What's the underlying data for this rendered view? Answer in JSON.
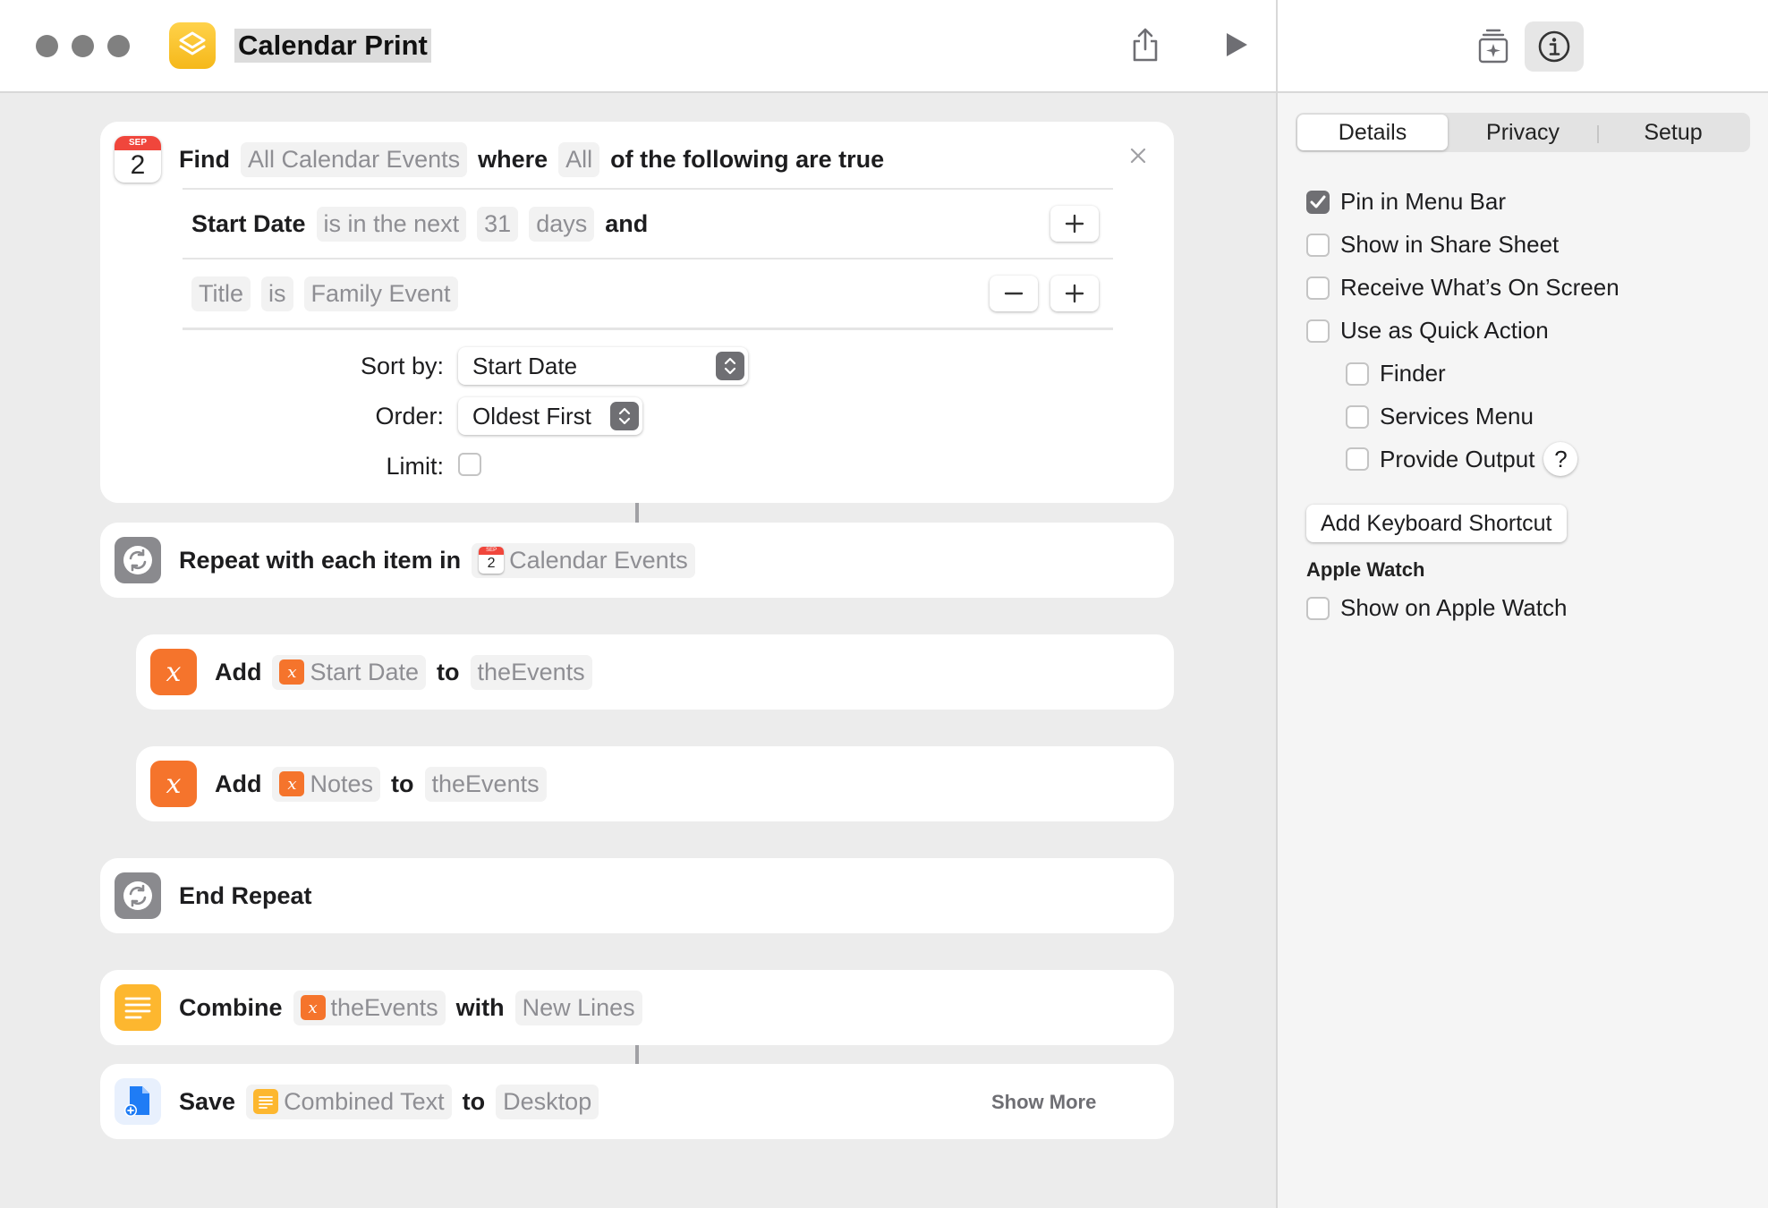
{
  "window": {
    "title": "Calendar Print"
  },
  "sidebar": {
    "tabs": [
      {
        "label": "Details",
        "active": true
      },
      {
        "label": "Privacy",
        "active": false
      },
      {
        "label": "Setup",
        "active": false
      }
    ],
    "options": [
      {
        "label": "Pin in Menu Bar",
        "checked": true
      },
      {
        "label": "Show in Share Sheet",
        "checked": false
      },
      {
        "label": "Receive What’s On Screen",
        "checked": false
      },
      {
        "label": "Use as Quick Action",
        "checked": false
      },
      {
        "label": "Finder",
        "checked": false
      },
      {
        "label": "Services Menu",
        "checked": false
      },
      {
        "label": "Provide Output",
        "checked": false
      }
    ],
    "help_label": "?",
    "keyboard_shortcut_button": "Add Keyboard Shortcut",
    "apple_watch_heading": "Apple Watch",
    "apple_watch_option": {
      "label": "Show on Apple Watch",
      "checked": false
    }
  },
  "actions": {
    "find": {
      "icon": {
        "month": "SEP",
        "day": "2"
      },
      "find_label": "Find",
      "source": "All Calendar Events",
      "where_label": "where",
      "quantifier": "All",
      "suffix": "of the following are true",
      "filter1": {
        "field": "Start Date",
        "op": "is in the next",
        "value": "31",
        "unit": "days",
        "conj": "and"
      },
      "filter2": {
        "field": "Title",
        "op": "is",
        "value": "Family Event"
      },
      "sort_label": "Sort by:",
      "sort_value": "Start Date",
      "order_label": "Order:",
      "order_value": "Oldest First",
      "limit_label": "Limit:",
      "limit_checked": false
    },
    "repeat": {
      "label": "Repeat with each item in",
      "var_month": "SEP",
      "var_day": "2",
      "var": "Calendar Events"
    },
    "add1": {
      "icon": "x",
      "label": "Add",
      "var_icon": "x",
      "var": "Start Date",
      "to": "to",
      "target": "theEvents"
    },
    "add2": {
      "icon": "x",
      "label": "Add",
      "var_icon": "x",
      "var": "Notes",
      "to": "to",
      "target": "theEvents"
    },
    "end_repeat": {
      "label": "End Repeat"
    },
    "combine": {
      "label": "Combine",
      "var_icon": "x",
      "var": "theEvents",
      "with": "with",
      "sep": "New Lines"
    },
    "save": {
      "label": "Save",
      "var": "Combined Text",
      "to": "to",
      "dest": "Desktop",
      "show_more": "Show More"
    }
  },
  "colors": {
    "accent_orange": "#f5742c",
    "accent_yellow": "#fdb72f",
    "calendar_red": "#f0463c",
    "neutral_gray": "#8a8a8e"
  }
}
